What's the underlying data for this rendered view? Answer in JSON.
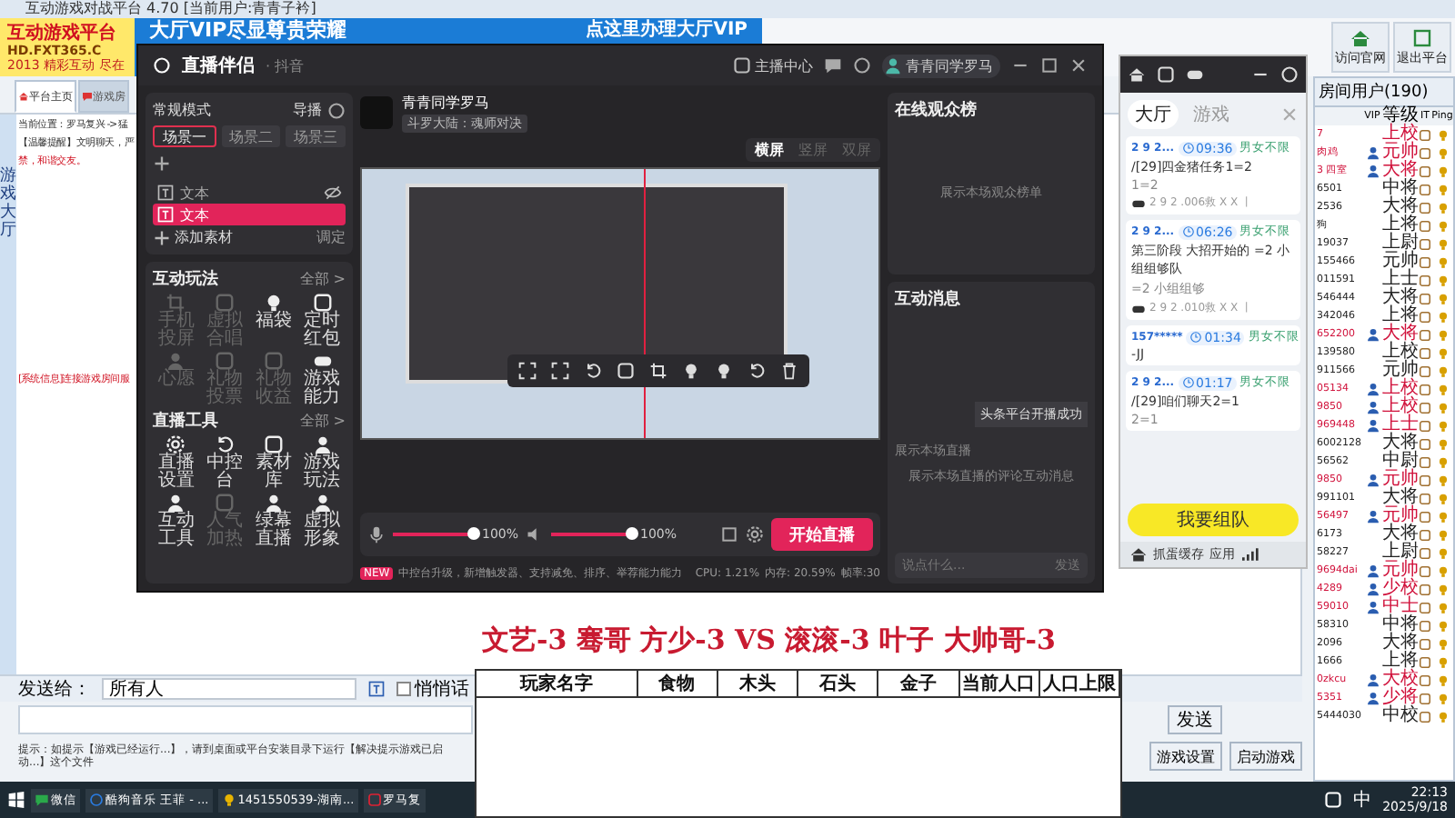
{
  "platform": {
    "title": "互动游戏对战平台 4.70 [当前用户:青青子衿]",
    "banner": {
      "logo": "互动游戏平台",
      "site": "HD.FXT365.C",
      "slogan": "2013 精彩互动 尽在",
      "ad": "大厅VIP尽显尊贵荣耀",
      "ad_right": "点这里办理大厅VIP"
    },
    "top_buttons": [
      "访问官网",
      "退出平台"
    ],
    "nav_tabs": [
      {
        "label": "平台主页",
        "selected": true
      },
      {
        "label": "游戏房",
        "selected": false
      }
    ],
    "location": "当前位置：罗马复兴 -> 猛",
    "notice": "【温馨提醒】文明聊天，严",
    "notice_end": "禁，和谐交友。",
    "side_tab": "游戏大厅",
    "system_message": "[系统信息]连接游戏房间服",
    "send_to_label": "发送给：",
    "send_to_value": "所有人",
    "whisper": {
      "label": "悄悄话",
      "checked": false
    },
    "hint": "提示：如提示【游戏已经运行...】，请到桌面或平台安装目录下运行【解决提示游戏已启动...】这个文件",
    "send_button": "发送",
    "bottom_buttons": [
      "游戏设置",
      "启动游戏"
    ],
    "room_tab": "房间用户(190)",
    "columns": [
      "VIP",
      "等级",
      "IT",
      "Ping"
    ],
    "users": [
      {
        "name": "7",
        "vip": false,
        "rank": "上校",
        "color": "#d0103a"
      },
      {
        "name": "肉鸡",
        "vip": true,
        "rank": "元帅",
        "color": "#d0103a"
      },
      {
        "name": "3 四室",
        "vip": true,
        "rank": "大将",
        "color": "#d0103a"
      },
      {
        "name": "6501",
        "vip": false,
        "rank": "中将",
        "color": "#222222"
      },
      {
        "name": "2536",
        "vip": false,
        "rank": "大将",
        "color": "#222222"
      },
      {
        "name": "狗",
        "vip": false,
        "rank": "上将",
        "color": "#222222"
      },
      {
        "name": "19037",
        "vip": false,
        "rank": "上尉",
        "color": "#222222"
      },
      {
        "name": "155466",
        "vip": false,
        "rank": "元帅",
        "color": "#222222"
      },
      {
        "name": "011591",
        "vip": false,
        "rank": "上士",
        "color": "#222222"
      },
      {
        "name": "546444",
        "vip": false,
        "rank": "大将",
        "color": "#222222"
      },
      {
        "name": "342046",
        "vip": false,
        "rank": "上将",
        "color": "#222222"
      },
      {
        "name": "652200",
        "vip": true,
        "rank": "大将",
        "color": "#d0103a"
      },
      {
        "name": "139580",
        "vip": false,
        "rank": "上校",
        "color": "#222222"
      },
      {
        "name": "911566",
        "vip": false,
        "rank": "元帅",
        "color": "#222222"
      },
      {
        "name": "05134",
        "vip": true,
        "rank": "上校",
        "color": "#d0103a"
      },
      {
        "name": "9850",
        "vip": true,
        "rank": "上校",
        "color": "#d0103a"
      },
      {
        "name": "969448",
        "vip": true,
        "rank": "上士",
        "color": "#d0103a"
      },
      {
        "name": "6002128",
        "vip": false,
        "rank": "大将",
        "color": "#222222"
      },
      {
        "name": "56562",
        "vip": false,
        "rank": "中尉",
        "color": "#222222"
      },
      {
        "name": "9850",
        "vip": true,
        "rank": "元帅",
        "color": "#d0103a"
      },
      {
        "name": "991101",
        "vip": false,
        "rank": "大将",
        "color": "#222222"
      },
      {
        "name": "56497",
        "vip": true,
        "rank": "元帅",
        "color": "#d0103a"
      },
      {
        "name": "6173",
        "vip": false,
        "rank": "大将",
        "color": "#222222"
      },
      {
        "name": "58227",
        "vip": false,
        "rank": "上尉",
        "color": "#222222"
      },
      {
        "name": "9694dai",
        "vip": true,
        "rank": "元帅",
        "color": "#d0103a"
      },
      {
        "name": "4289",
        "vip": true,
        "rank": "少校",
        "color": "#d0103a"
      },
      {
        "name": "59010",
        "vip": true,
        "rank": "中士",
        "color": "#d0103a"
      },
      {
        "name": "58310",
        "vip": false,
        "rank": "中将",
        "color": "#222222"
      },
      {
        "name": "2096",
        "vip": false,
        "rank": "大将",
        "color": "#222222"
      },
      {
        "name": "1666",
        "vip": false,
        "rank": "上将",
        "color": "#222222"
      },
      {
        "name": "0zkcu",
        "vip": true,
        "rank": "大校",
        "color": "#d0103a"
      },
      {
        "name": "5351",
        "vip": true,
        "rank": "少将",
        "color": "#d0103a"
      },
      {
        "name": "5444030",
        "vip": false,
        "rank": "中校",
        "color": "#222222"
      }
    ]
  },
  "stream": {
    "app_title": "直播伴侣",
    "app_platform": "· 抖音",
    "center_link": "主播中心",
    "account": "青青同学罗马",
    "mode": "常规模式",
    "director": "导播",
    "scenes": [
      {
        "label": "场景一",
        "selected": true
      },
      {
        "label": "场景二",
        "selected": false
      },
      {
        "label": "场景三",
        "selected": false
      }
    ],
    "sources": [
      {
        "label": "文本",
        "selected": false
      },
      {
        "label": "文本",
        "selected": true
      }
    ],
    "add_source": "添加素材",
    "source_action": "调定",
    "sections": [
      {
        "title": "互动玩法",
        "more": "全部 >",
        "items": [
          {
            "label": "手机投屏",
            "disabled": true
          },
          {
            "label": "虚拟合唱",
            "disabled": true
          },
          {
            "label": "福袋",
            "disabled": false
          },
          {
            "label": "定时红包",
            "disabled": false
          },
          {
            "label": "心愿",
            "disabled": true
          },
          {
            "label": "礼物投票",
            "disabled": true
          },
          {
            "label": "礼物收益",
            "disabled": true
          },
          {
            "label": "游戏能力",
            "disabled": false
          }
        ]
      },
      {
        "title": "直播工具",
        "more": "全部 >",
        "items": [
          {
            "label": "直播设置",
            "disabled": false
          },
          {
            "label": "中控台",
            "disabled": false
          },
          {
            "label": "素材库",
            "disabled": false
          },
          {
            "label": "游戏玩法",
            "disabled": false
          },
          {
            "label": "互动工具",
            "disabled": false
          },
          {
            "label": "人气加热",
            "disabled": true
          },
          {
            "label": "绿幕直播",
            "disabled": false
          },
          {
            "label": "虚拟形象",
            "disabled": false
          }
        ]
      }
    ],
    "streamer": "青青同学罗马",
    "game": "斗罗大陆：魂师对决",
    "layouts": [
      {
        "label": "横屏",
        "selected": true
      },
      {
        "label": "竖屏",
        "selected": false
      },
      {
        "label": "双屏",
        "selected": false
      }
    ],
    "mic": {
      "level": 1,
      "reading": "100%"
    },
    "speaker": {
      "level": 1,
      "reading": "100%"
    },
    "start_button": "开始直播",
    "news_badge": "NEW",
    "news": "中控台升级，新增触发器、支持减免、排序、举荐能力能力",
    "stats": [
      "CPU: 1.21%",
      "内存: 20.59%",
      "帧率:30"
    ],
    "audience": {
      "title": "在线观众榜",
      "empty": "展示本场观众榜单"
    },
    "messages": {
      "title": "互动消息",
      "empty_top": "展示本场直播",
      "toast": "头条平台开播成功",
      "empty": "展示本场直播的评论互动消息",
      "placeholder": "说点什么...",
      "send": "发送"
    }
  },
  "team": {
    "tabs": [
      {
        "label": "大厅",
        "selected": true
      },
      {
        "label": "游戏",
        "selected": false
      }
    ],
    "cards": [
      {
        "user": "2 9 2...",
        "time": "09:36",
        "tag": "男女不限",
        "text": "/[29]四金猪任务1=2",
        "sub": "1=2",
        "room": "2 9 2 .006救 X X 丨"
      },
      {
        "user": "2 9 2...",
        "time": "06:26",
        "tag": "男女不限",
        "text": "第三阶段 大招开始的 =2 小组组够队",
        "sub": "=2 小组组够",
        "room": "2 9 2 .010救 X X 丨"
      },
      {
        "user": "157*****",
        "time": "01:34",
        "tag": "男女不限",
        "text": "-JJ"
      },
      {
        "user": "2 9 2...",
        "time": "01:17",
        "tag": "男女不限",
        "text": "/[29]咱们聊天2=1",
        "sub": "2=1"
      }
    ],
    "join_button": "我要组队",
    "footer": "抓蛋缓存",
    "footer_app": "应用"
  },
  "overlay": {
    "match": "文艺-3 骞哥 方少-3 VS 滚滚-3 叶子 大帅哥-3",
    "columns": [
      "玩家名字",
      "食物",
      "木头",
      "石头",
      "金子",
      "当前人口",
      "人口上限"
    ]
  },
  "taskbar": {
    "apps": [
      "微信",
      "酷狗音乐 王菲 - ...",
      "1451550539-湖南...",
      "罗马复"
    ],
    "ime": "中",
    "time": "22:13",
    "date": "2025/9/18"
  }
}
